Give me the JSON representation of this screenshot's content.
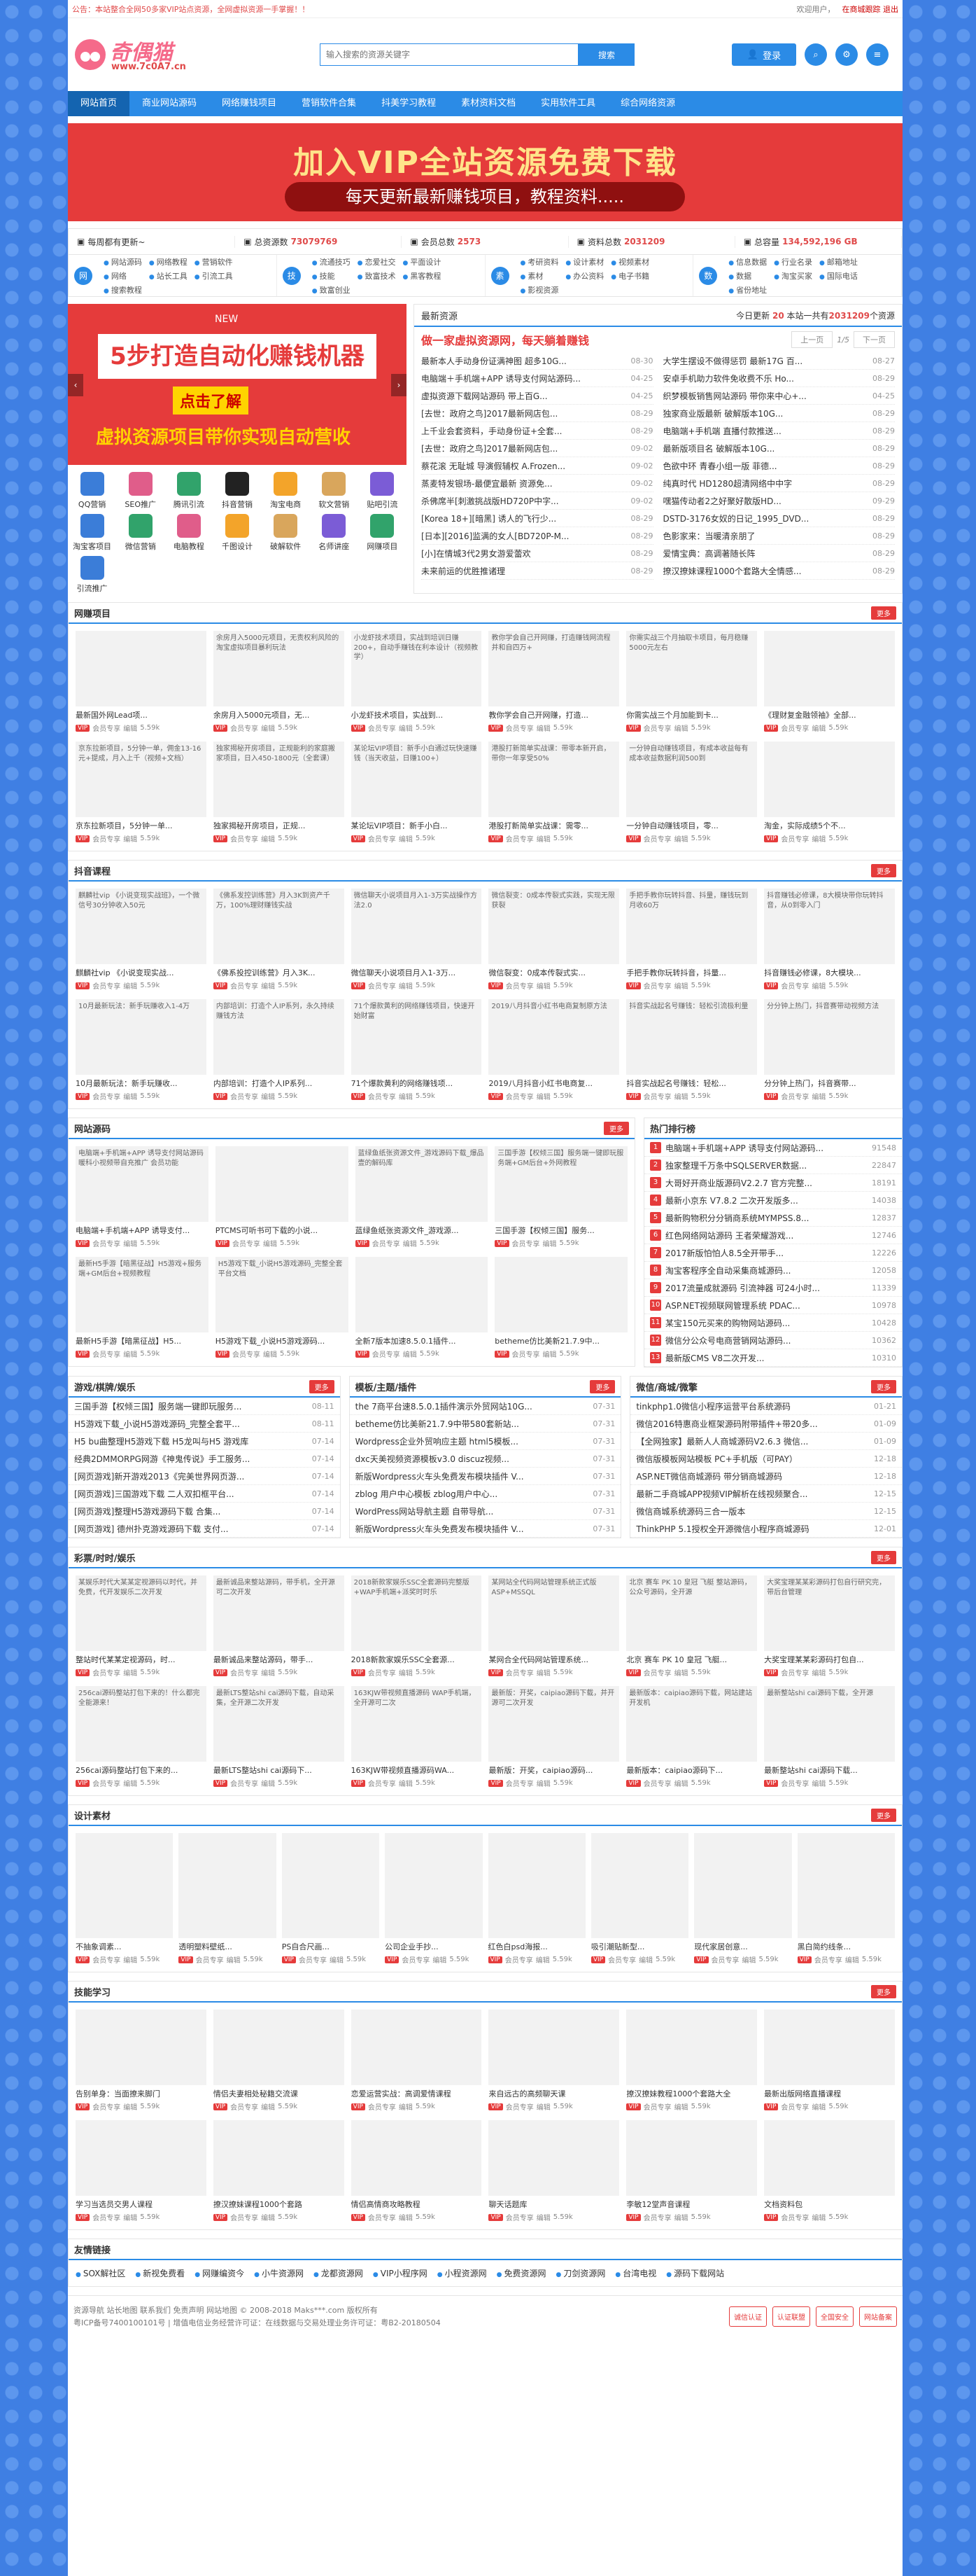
{
  "topbar": {
    "notice": "公告：本站整合全网50多家VIP站点资源，全网虚拟资源一手掌握！！",
    "welcome": "欢迎用户，",
    "logout": "在商城跟踪 退出"
  },
  "header": {
    "logo_text": "奇偶猫",
    "logo_url": "www.7c0A7.cn",
    "search_placeholder": "输入搜索的资源关键字",
    "search_button": "搜索",
    "login": "登录"
  },
  "nav": [
    "网站首页",
    "商业网站源码",
    "网络赚钱项目",
    "营销软件合集",
    "抖美学习教程",
    "素材资料文档",
    "实用软件工具",
    "综合网络资源"
  ],
  "banner": {
    "line1": "加入VIP全站资源免费下载",
    "line2": "每天更新最新赚钱项目，教程资料....."
  },
  "stats": [
    {
      "label": "每周都有更新~",
      "val": ""
    },
    {
      "label": "总资源数",
      "val": "73079769"
    },
    {
      "label": "会员总数",
      "val": "2573"
    },
    {
      "label": "资料总数",
      "val": "2031209"
    },
    {
      "label": "总容量",
      "val": "134,592,196 GB"
    }
  ],
  "quick": [
    {
      "icon": "网",
      "links": [
        "网站源码",
        "网络教程",
        "营销软件",
        "网络",
        "站长工具",
        "引流工具",
        "搜索教程"
      ]
    },
    {
      "icon": "技",
      "links": [
        "流通技巧",
        "恋爱社交",
        "平面设计",
        "技能",
        "致富技术",
        "黑客教程",
        "致富创业"
      ]
    },
    {
      "icon": "素",
      "links": [
        "考研资料",
        "设计素材",
        "视频素材",
        "素材",
        "办公资料",
        "电子书籍",
        "影视资源"
      ]
    },
    {
      "icon": "数",
      "links": [
        "信息数据",
        "行业名录",
        "邮箱地址",
        "数据",
        "淘宝买家",
        "国际电话",
        "省份地址"
      ]
    }
  ],
  "slider": {
    "new": "NEW",
    "l1": "5步打造自动化赚钱机器",
    "l2": "点击了解",
    "l3": "虚拟资源项目带你实现自动营收"
  },
  "icons": [
    {
      "n": "QQ营销",
      "c": "c2"
    },
    {
      "n": "SEO推广",
      "c": "c3"
    },
    {
      "n": "腾讯引流",
      "c": "c4"
    },
    {
      "n": "抖音营销",
      "c": "c7"
    },
    {
      "n": "淘宝电商",
      "c": "c5"
    },
    {
      "n": "软文营销",
      "c": "c1"
    },
    {
      "n": "贴吧引流",
      "c": "c6"
    },
    {
      "n": "淘宝客项目",
      "c": "c2"
    },
    {
      "n": "微信营销",
      "c": "c4"
    },
    {
      "n": "电脑教程",
      "c": "c3"
    },
    {
      "n": "千图设计",
      "c": "c5"
    },
    {
      "n": "破解软件",
      "c": "c1"
    },
    {
      "n": "名师讲座",
      "c": "c6"
    },
    {
      "n": "网赚项目",
      "c": "c4"
    },
    {
      "n": "引流推广",
      "c": "c2"
    }
  ],
  "news": {
    "head": "最新资源",
    "count_pre": "今日更新",
    "today": "20",
    "count_mid": "本站一共有",
    "total": "2031209",
    "count_suf": "个资源",
    "subtitle": "做一家虚拟资源网，每天躺着赚钱",
    "prev": "上一页",
    "page": "1/5",
    "next": "下一页",
    "items": [
      [
        "最新本人手动身份证满神图 超多10G...",
        "08-30"
      ],
      [
        "大学生摆设不做得惩罚 最新17G 百...",
        "08-27"
      ],
      [
        "电脑端＋手机端+APP 诱导支付网站源码...",
        "04-25"
      ],
      [
        "安卓手机助力软件免收费不乐 Ho...",
        "08-29"
      ],
      [
        "虚拟资源下载网站源码 带上百G...",
        "04-25"
      ],
      [
        "织梦模板销售网站源码 带你来中心+...",
        "04-25"
      ],
      [
        "[去世：政府之鸟]2017最新网店包...",
        "08-29"
      ],
      [
        "独家商业版最新 破解版本10G...",
        "08-29"
      ],
      [
        "上千业会套资料，手动身份证+全套...",
        "08-29"
      ],
      [
        "电脑端+手机端 直播付款推送...",
        "08-29"
      ],
      [
        "[去世：政府之鸟]2017最新网店包...",
        "09-02"
      ],
      [
        "最新版项目名 破解版本10G...",
        "08-29"
      ],
      [
        "蔡花滚 无耻城 导演假辅权 A.Frozen...",
        "09-02"
      ],
      [
        "色欲中环 青春小组一版 菲德...",
        "08-29"
      ],
      [
        "蒸麦特发银场-最便宜最新 资源免...",
        "09-02"
      ],
      [
        "纯真时代 HD1280超清网络中中字",
        "08-29"
      ],
      [
        "杀佛席半[刺激挑战版HD720P中字...",
        "09-02"
      ],
      [
        "嘿猫传动者2之好聚好散版HD...",
        "09-29"
      ],
      [
        "[Korea 18+][暗黑] 诱人的飞行少...",
        "08-29"
      ],
      [
        "DSTD-3176女奴的日记_1995_DVD...",
        "08-29"
      ],
      [
        "[日本][2016]监满的女人[BD720P-M...",
        "08-29"
      ],
      [
        "色影家来：当暖清亲朋了",
        "08-29"
      ],
      [
        "[小]在情城3代2男女游爱蕾欢",
        "08-29"
      ],
      [
        "爱情宝典：高调著随长阵",
        "08-29"
      ],
      [
        "未来前运的优胜推诸理",
        "08-29"
      ],
      [
        "撩汉撩妹课程1000个套路大全情感...",
        "08-29"
      ]
    ]
  },
  "sec_wangzhuan": {
    "title": "网赚项目",
    "more": "更多",
    "cards": [
      {
        "alt": "",
        "cap": "最新国外网Lead项...",
        "thumb": "c1"
      },
      {
        "alt": "余房月入5000元项目，无责权利风险的淘宝虚拟项目暴利玩法",
        "cap": "余房月入5000元项目，无..."
      },
      {
        "alt": "小龙虾技术项目，实战到培训日赚200+，自动手赚钱在利本设计（视频教学）",
        "cap": "小龙虾技术项目，实战到..."
      },
      {
        "alt": "教你学会自己开网赚，打造赚钱网流程并和自四万+",
        "cap": "教你学会自己开网赚，打造..."
      },
      {
        "alt": "你需实战三个月抽取卡项目，每月稳赚5000元左右",
        "cap": "你需实战三个月加能到卡..."
      },
      {
        "alt": "",
        "cap": "《理财复金融领袖》全部...",
        "thumb": "c5"
      },
      {
        "alt": "京东拉新项目，5分钟一单，佣金13-16元+提成，月入上千（视频+文档）",
        "cap": "京东拉新项目，5分钟一单..."
      },
      {
        "alt": "独家揭秘开房项目，正规能利的家庭搬家项目，日入450-1800元（全套课）",
        "cap": "独家揭秘开房项目，正规..."
      },
      {
        "alt": "某论坛VIP项目：新手小白通过玩快速赚钱（当天收益，日赚100+）",
        "cap": "某论坛VIP项目：新手小白..."
      },
      {
        "alt": "港股打新简单实战课：带零本新开启，带你一年享受50%",
        "cap": "港股打新简单实战课：需零..."
      },
      {
        "alt": "一分钟自动赚钱项目，有成本收益每有成本收益数据利润500到",
        "cap": "一分钟自动赚钱项目，零..."
      },
      {
        "alt": "",
        "cap": "淘金，实际成绩5个不...",
        "thumb": "c5"
      }
    ]
  },
  "sec_douyin": {
    "title": "抖音课程",
    "more": "更多",
    "cards": [
      {
        "alt": "麒麟社vip 《小说变现实战班》，一个微信号30分钟收入50元",
        "cap": "麒麟社vip 《小说变现实战..."
      },
      {
        "alt": "《佛系发控训练营》月入3K到资产千万，100%理财赚钱实战",
        "cap": "《佛系投控训练营》月入3K..."
      },
      {
        "alt": "微信聊天小说项目月入1-3万实战操作方法2.0",
        "cap": "微信聊天小说项目月入1-3万..."
      },
      {
        "alt": "微信裂变：0成本传裂式实践，实现无限获裂",
        "cap": "微信裂变：0成本传裂式实..."
      },
      {
        "alt": "手把手教你玩转抖音、抖量，赚钱玩到月收60万",
        "cap": "手把手教你玩转抖音，抖量..."
      },
      {
        "alt": "抖音赚钱必修课，8大模块带你玩转抖音，从0到零入门",
        "cap": "抖音赚钱必修课，8大模块..."
      },
      {
        "alt": "10月最新玩法：新手玩赚收入1-4万",
        "cap": "10月最新玩法：新手玩赚收..."
      },
      {
        "alt": "内部培训：打造个人IP系列，永久持续赚钱方法",
        "cap": "内部培训：打造个人IP系列..."
      },
      {
        "alt": "71个爆款黄利的网络赚钱项目，快速开始财富",
        "cap": "71个爆款黄利的网络赚钱项..."
      },
      {
        "alt": "2019八月抖音小红书电商复制原方法",
        "cap": "2019八月抖音小红书电商复..."
      },
      {
        "alt": "抖音实战起名号赚钱：轻松引流极利量",
        "cap": "抖音实战起名号赚钱：轻松..."
      },
      {
        "alt": "分分钟上热门，抖音赛带动视频方法",
        "cap": "分分钟上热门，抖音赛带..."
      }
    ]
  },
  "sec_source": {
    "title": "网站源码",
    "more": "更多",
    "cards": [
      {
        "alt": "电脑端+手机端+APP 诱导支付网站源码 暖科小视频带自充推广 会员功能",
        "cap": "电脑端+手机端+APP 诱导支付..."
      },
      {
        "alt": "",
        "cap": "PTCMS可听书可下载的小说...",
        "thumb": "c1"
      },
      {
        "alt": "蓝绿鱼纸张资源文件_游戏源码下载_爆品壹的解码库",
        "cap": "蓝绿鱼纸张资源文件_游戏源..."
      },
      {
        "alt": "三国手游【权倾三国】服务端一键即玩服务端+GM后台+外网教程",
        "cap": "三国手游【权倾三国】服务..."
      },
      {
        "alt": "最新H5手游【暗黑征战】H5游戏+服务端+GM后台+视频教程",
        "cap": "最新H5手游【暗黑征战】H5..."
      },
      {
        "alt": "H5游戏下载_小说H5游戏源码_完整全套平台文档",
        "cap": "H5游戏下载_小说H5游戏源码..."
      },
      {
        "alt": "",
        "cap": "全新7版本加速8.5.0.1插件...",
        "thumb": "c7"
      },
      {
        "alt": "",
        "cap": "betheme仿比美新21.7.9中...",
        "thumb": "c7"
      }
    ]
  },
  "ranking": {
    "title": "热门排行榜",
    "items": [
      [
        "电脑端+手机端+APP 诱导支付网站源码...",
        "91548"
      ],
      [
        "独家整理千万条中SQLSERVER数据...",
        "22847"
      ],
      [
        "大哥好开商业版源码V2.2.7 官方完整...",
        "18191"
      ],
      [
        "最新小京东 V7.8.2 二次开发版多...",
        "14038"
      ],
      [
        "最新购物积分分销商系统MYMPSS.8...",
        "12837"
      ],
      [
        "红色网络网站源码 王者荣耀游戏...",
        "12746"
      ],
      [
        "2017新版怕怕人8.5全开带手...",
        "12226"
      ],
      [
        "淘宝客程序全自动采集商城源码...",
        "12058"
      ],
      [
        "2017流量成就源码 引流神器 可24小时...",
        "11339"
      ],
      [
        "ASP.NET视频联网管理系统 PDAC...",
        "10978"
      ],
      [
        "某宝150元买来的购物网站源码...",
        "10428"
      ],
      [
        "微信分公众号电商营销网站源码...",
        "10362"
      ],
      [
        "最新版CMS V8二次开发...",
        "10310"
      ]
    ]
  },
  "sec_game": {
    "title": "游戏/棋牌/娱乐",
    "more": "更多",
    "items": [
      [
        "三国手游【权倾三国】服务端一键即玩服务...",
        "08-11"
      ],
      [
        "H5游戏下载_小说H5游戏源码_完整全套平...",
        "08-11"
      ],
      [
        "H5 bu曲整理H5游戏下载 H5龙叫与H5 游戏库",
        "07-14"
      ],
      [
        "经典2DMMORPG网游《神鬼传说》手工服务...",
        "07-14"
      ],
      [
        "[网页游戏]新开游戏2013《完美世界网页游...",
        "07-14"
      ],
      [
        "[网页游戏]三国游戏下载 二人双扣框平台...",
        "07-14"
      ],
      [
        "[网页游戏]整理H5游戏源码下载 合集...",
        "07-14"
      ],
      [
        "[网页游戏] 德州扑克游戏源码下载 支付...",
        "07-14"
      ]
    ]
  },
  "sec_template": {
    "title": "模板/主题/插件",
    "more": "更多",
    "items": [
      [
        "the 7商平台速8.5.0.1插件演示外贸网站10G...",
        "07-31"
      ],
      [
        "betheme仿比美新21.7.9中带580套新站...",
        "07-31"
      ],
      [
        "Wordpress企业外贸响应主题 html5模板...",
        "07-31"
      ],
      [
        "dxc天美视频资源模板v3.0 discuz视频...",
        "07-31"
      ],
      [
        "新版Wordpress火车头免费发布模块插件 V...",
        "07-31"
      ],
      [
        "zblog 用户中心模板 zblog用户中心...",
        "07-31"
      ],
      [
        "WordPress网站导航主题 自带导航...",
        "07-31"
      ],
      [
        "新版Wordpress火车头免费发布模块插件 V...",
        "07-31"
      ]
    ]
  },
  "sec_wechat": {
    "title": "微信/商城/微擎",
    "more": "更多",
    "items": [
      [
        "tinkphp1.0微信小程序运营平台系统源码",
        "01-21"
      ],
      [
        "微信2016特惠商业框架源码附带插件+带20多...",
        "01-09"
      ],
      [
        "【全网独家】最新人人商城源码V2.6.3 微信...",
        "01-09"
      ],
      [
        "微信版模板网站模板 PC+手机版（可PAY）",
        "12-18"
      ],
      [
        "ASP.NET微信商城源码 带分销商城源码",
        "12-18"
      ],
      [
        "最新二手商城APP视频VIP解析在线视频聚合...",
        "12-15"
      ],
      [
        "微信商城系统源码三合一版本",
        "12-15"
      ],
      [
        "ThinkPHP 5.1授权全开源微信小程序商城源码",
        "12-01"
      ]
    ]
  },
  "sec_film": {
    "title": "彩票/时时/娱乐",
    "more": "更多",
    "cards": [
      {
        "alt": "某娱乐时代大某某定视源码以时代，并免费，代开发娱乐二次开发",
        "cap": "整站时代某某定视源码，时..."
      },
      {
        "alt": "最新诚品来整站源码，带手机，全开源可二次开发",
        "cap": "最新诚品来整站源码，带手..."
      },
      {
        "alt": "2018新款家娱乐SSC全套源码完整版+WAP手机端+派奖时时乐",
        "cap": "2018新款家娱乐SSC全套源..."
      },
      {
        "alt": "某网站全代码网站管理系统正式版 ASP+MSSQL",
        "cap": "某网合全代码网站管理系统..."
      },
      {
        "alt": "北京 赛车 PK 10 皇冠 飞艇 整站源码，公众号源码，全开源",
        "cap": "北京 赛车 PK 10 皇冠 飞艇..."
      },
      {
        "alt": "大奖宝理某某彩源码打包自行研究完，带后台管理",
        "cap": "大奖宝理某某彩源码打包自..."
      },
      {
        "alt": "256cai源码整站打包下来的！什么都完全能源来！",
        "cap": "256cai源码整站打包下来的..."
      },
      {
        "alt": "最新LTS整站shi cai源码下载，自动采集，全开源二次开发",
        "cap": "最新LTS整站shi cai源码下..."
      },
      {
        "alt": "163KJW带视频直播源码 WAP手机端，全开源可二次",
        "cap": "163KJW带视频直播源码WA..."
      },
      {
        "alt": "最新版：开奖，caipiao源码下载，并开源可二次开发",
        "cap": "最新版：开奖，caipiao源码..."
      },
      {
        "alt": "最新版本：caipiao源码下载，网站建站开发机",
        "cap": "最新版本：caipiao源码下..."
      },
      {
        "alt": "最新整站shi cai源码下载，全开源",
        "cap": "最新整站shi cai源码下载..."
      }
    ]
  },
  "sec_design": {
    "title": "设计素材",
    "more": "更多",
    "cards": [
      {
        "cap": "不抽象调素...",
        "thumb": "c7"
      },
      {
        "cap": "透明塑料壁纸...",
        "thumb": "c1"
      },
      {
        "cap": "PS自合尺画...",
        "thumb": "c7"
      },
      {
        "cap": "公司企业手抄...",
        "thumb": "c5"
      },
      {
        "cap": "红色白psd海报...",
        "thumb": "c3"
      },
      {
        "cap": "吸引潮贴新型...",
        "thumb": "c7"
      },
      {
        "cap": "现代家居创意...",
        "thumb": "c1"
      },
      {
        "cap": "黑白简约线条...",
        "thumb": "c7"
      }
    ]
  },
  "sec_skill": {
    "title": "技能学习",
    "more": "更多",
    "cards": [
      {
        "cap": "告别单身：当面撩来脚门",
        "thumb": "c2"
      },
      {
        "cap": "情侣夫妻相处秘籍交流课",
        "thumb": "c5"
      },
      {
        "cap": "恋爱运营实战：高调爱情课程",
        "thumb": "c3"
      },
      {
        "cap": "来自远古的高频聊天课",
        "thumb": "c2"
      },
      {
        "cap": "撩汉撩妹教程1000个套路大全",
        "thumb": "c5"
      },
      {
        "cap": "最新出版网络直播课程",
        "thumb": "c7"
      },
      {
        "cap": "学习当选员交男人课程",
        "thumb": "c3"
      },
      {
        "cap": "撩汉撩妹课程1000个套路",
        "thumb": "c3"
      },
      {
        "cap": "情侣高情商攻略教程",
        "thumb": "c5"
      },
      {
        "cap": "聊天话题库",
        "thumb": "c5"
      },
      {
        "cap": "李敏12堂声音课程",
        "thumb": "c5"
      },
      {
        "cap": "文档资料包",
        "thumb": "c6"
      }
    ]
  },
  "meta": {
    "vip": "VIP",
    "user": "会员专享",
    "edit": "编辑",
    "views": "5.59k"
  },
  "links": {
    "title": "友情链接",
    "items": [
      "SOX解社区",
      "新视免费看",
      "网赚编资今",
      "小牛资源网",
      "龙都资源网",
      "VIP小程序网",
      "小程资源网",
      "免费资源网",
      "刀剑资源网",
      "台湾电视",
      "源码下载网站"
    ]
  },
  "footer": {
    "l1": "资源导航  站长地图  联系我们  免责声明  网站地图  © 2008-2018 Maks***.com 版权所有",
    "l2": "粤ICP备号7400100101号 | 增值电信业务经营许可证：在线数据与交易处理业务许可证：粤B2-20180504",
    "badges": [
      "诚信认证",
      "认证联盟",
      "全国安全",
      "网站备案"
    ]
  }
}
